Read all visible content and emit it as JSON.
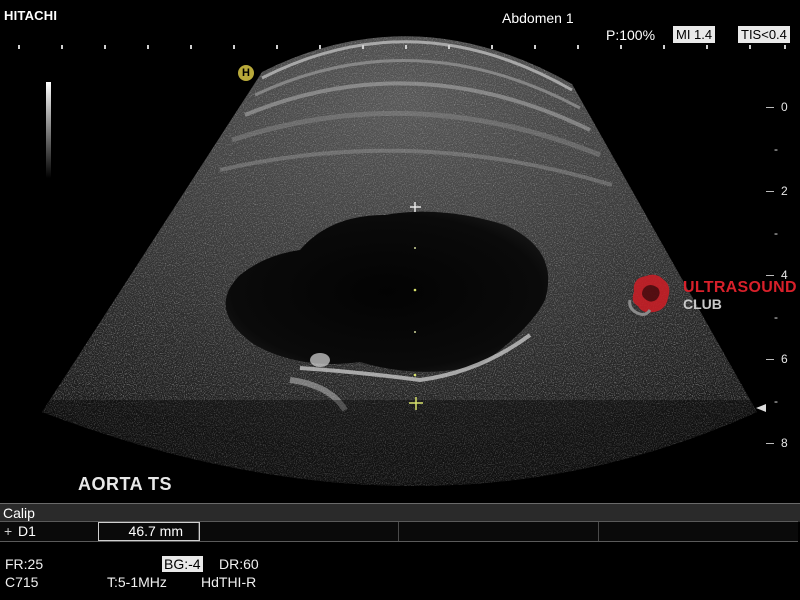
{
  "header": {
    "brand": "HITACHI",
    "preset": "Abdomen 1",
    "power": "P:100%",
    "mi": "MI 1.4",
    "tis": "TIS<0.4"
  },
  "image": {
    "marker": "H",
    "view_label": "AORTA  TS",
    "depth_labels": [
      "0",
      "-",
      "2",
      "-",
      "4",
      "-",
      "6",
      "-",
      "8"
    ]
  },
  "watermark": {
    "line1": "ULTRASOUND",
    "line2": "CLUB",
    "accent_color": "#d8202a"
  },
  "calip": {
    "title": "Calip",
    "measurement_label": "D1",
    "measurement_value": "46.7 mm"
  },
  "status": {
    "fr": "FR:25",
    "bg": "BG:-4",
    "dr": "DR:60",
    "probe": "C715",
    "freq": "T:5-1MHz",
    "mode": "HdTHI-R"
  }
}
